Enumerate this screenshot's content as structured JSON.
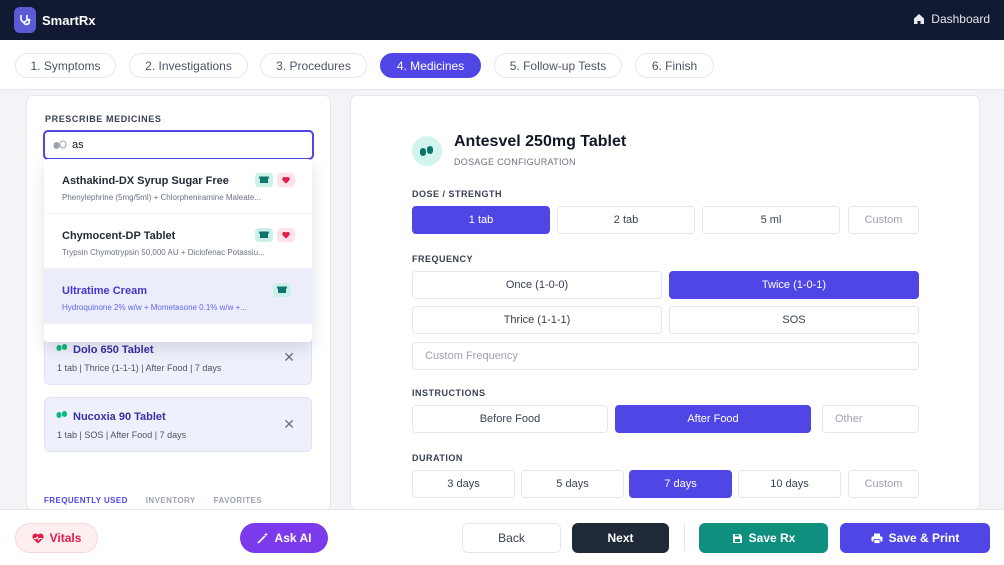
{
  "app": {
    "name": "SmartRx",
    "dashboard_label": "Dashboard"
  },
  "steps": [
    {
      "label": "1. Symptoms",
      "active": false
    },
    {
      "label": "2. Investigations",
      "active": false
    },
    {
      "label": "3. Procedures",
      "active": false
    },
    {
      "label": "4. Medicines",
      "active": true
    },
    {
      "label": "5. Follow-up Tests",
      "active": false
    },
    {
      "label": "6. Finish",
      "active": false
    }
  ],
  "prescribe": {
    "title": "PRESCRIBE MEDICINES",
    "search_value": "as",
    "suggestions": [
      {
        "name": "Asthakind-DX Syrup Sugar Free",
        "composition": "Phenylephrine (5mg/5ml) + Chlorpheniramine Maleate...",
        "badges": [
          "inventory-icon",
          "heart-icon"
        ]
      },
      {
        "name": "Chymocent-DP Tablet",
        "composition": "Trypsin Chymotrypsin 50,000 AU + Diclofenac Potassiu...",
        "badges": [
          "inventory-icon",
          "heart-icon"
        ]
      },
      {
        "name": "Ultratime Cream",
        "composition": "Hydroquinone 2% w/w + Mometasone 0.1% w/w +...",
        "badges": [
          "inventory-icon"
        ],
        "selected": true
      }
    ],
    "prescribed": [
      {
        "name": "Dolo 650 Tablet",
        "detail": "1 tab | Thrice (1-1-1) | After Food | 7 days"
      },
      {
        "name": "Nucoxia 90 Tablet",
        "detail": "1 tab | SOS | After Food | 7 days"
      }
    ],
    "bottom_tabs": [
      "FREQUENTLY USED",
      "INVENTORY",
      "FAVORITES"
    ]
  },
  "config": {
    "medicine": "Antesvel 250mg Tablet",
    "subtitle": "DOSAGE CONFIGURATION",
    "dose_label": "DOSE / STRENGTH",
    "dose_options": [
      "1 tab",
      "2 tab",
      "5 ml"
    ],
    "dose_custom": "Custom",
    "frequency_label": "FREQUENCY",
    "frequency_options": [
      "Once (1-0-0)",
      "Twice (1-0-1)",
      "Thrice (1-1-1)",
      "SOS"
    ],
    "frequency_custom": "Custom Frequency",
    "instructions_label": "INSTRUCTIONS",
    "instructions_options": [
      "Before Food",
      "After Food"
    ],
    "instructions_other": "Other",
    "duration_label": "DURATION",
    "duration_options": [
      "3 days",
      "5 days",
      "7 days",
      "10 days"
    ],
    "duration_custom": "Custom"
  },
  "footer": {
    "vitals": "Vitals",
    "ask_ai": "Ask AI",
    "back": "Back",
    "next": "Next",
    "save_rx": "Save Rx",
    "save_print": "Save & Print"
  },
  "colors": {
    "primary": "#4f46e5",
    "dark": "#121a33",
    "teal": "#0f8f7e",
    "ai": "#7c3aed",
    "danger": "#e11d48"
  }
}
